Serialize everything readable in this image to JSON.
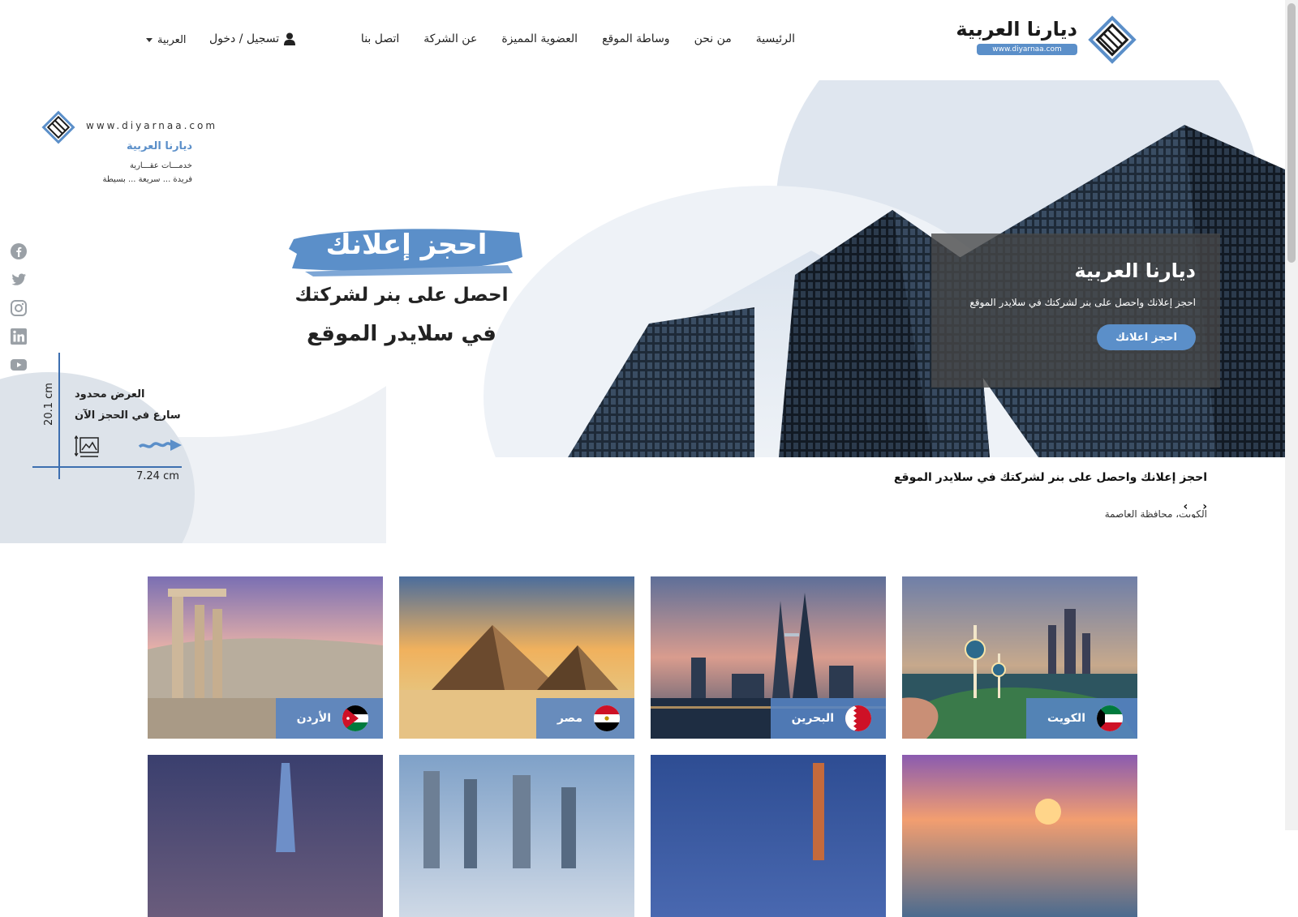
{
  "header": {
    "logo_title": "ديارنا العربية",
    "logo_url": "www.diyarnaa.com",
    "nav": [
      "الرئيسية",
      "من نحن",
      "وساطة الموقع",
      "العضوية المميزة",
      "عن الشركة",
      "اتصل بنا"
    ],
    "login": "تسجيل / دخول",
    "language": "العربية"
  },
  "hero": {
    "overlay_title": "ديارنا العربية",
    "overlay_text": "احجز إعلانك واحصل على بنر لشركتك في سلايدر الموقع",
    "overlay_button": "احجز اعلانك",
    "brush_text": "احجز إعلانك",
    "promo_line1": "احصل على بنر لشركتك",
    "promo_line2": "في سلايدر الموقع",
    "small_url": "www.diyarnaa.com",
    "small_brand": "ديارنا العربية",
    "small_tag1": "خدمـــات عقـــارية",
    "small_tag2": "فريدة ... سريعة ... بسيطة",
    "offer_line1": "العرض محدود",
    "offer_line2": "سارع في الحجز الآن",
    "dim_vertical": "20.1 cm",
    "dim_horizontal": "7.24 cm",
    "caption_title": "احجز إعلانك واحصل على بنر لشركتك في سلايدر الموقع",
    "caption_prev": "‹",
    "caption_next": "›",
    "caption_sub": "الكويت، محافظة العاصمة"
  },
  "social_icons": [
    "facebook-icon",
    "twitter-icon",
    "instagram-icon",
    "linkedin-icon",
    "youtube-icon"
  ],
  "countries": [
    {
      "name": "الكويت",
      "flag": "kuwait"
    },
    {
      "name": "البحرين",
      "flag": "bahrain"
    },
    {
      "name": "مصر",
      "flag": "egypt"
    },
    {
      "name": "الأردن",
      "flag": "jordan"
    }
  ],
  "colors": {
    "accent": "#5b8fc9",
    "overlay": "#464646",
    "card_label": "#5684c4"
  }
}
